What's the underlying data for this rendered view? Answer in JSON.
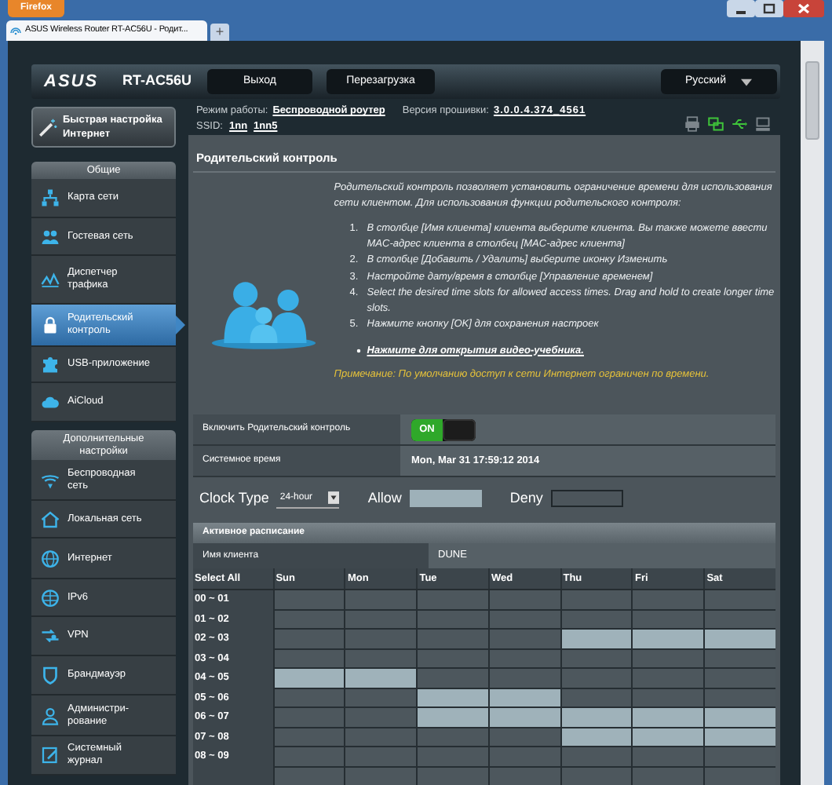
{
  "browser": {
    "menu_button": "Firefox",
    "tab_title": "ASUS Wireless Router RT-AC56U - Родит...",
    "new_tab": "+"
  },
  "header": {
    "logo": "ASUS",
    "model": "RT-AC56U",
    "buttons": [
      "Выход",
      "Перезагрузка"
    ],
    "language": "Русский"
  },
  "info": {
    "mode_label": "Режим работы:",
    "mode": "Беспроводной роутер",
    "firmware_label": "Версия прошивки:",
    "firmware": "3.0.0.4.374_4561",
    "ssid_label": "SSID:",
    "ssids": [
      "1nn",
      "1nn5"
    ]
  },
  "status_icons": [
    {
      "on": false
    },
    {
      "on": true
    },
    {
      "on": true
    },
    {
      "on": false
    }
  ],
  "quick_setup": "Быстрая настройка\nИнтернет",
  "sidebar": [
    {
      "title": "Общие",
      "items": [
        {
          "label": "Карта сети",
          "selected": false
        },
        {
          "label": "Гостевая сеть",
          "selected": false
        },
        {
          "label": "Диспетчер\nтрафика",
          "selected": false
        },
        {
          "label": "Родительский\nконтроль",
          "selected": true
        },
        {
          "label": "USB-приложение",
          "selected": false
        },
        {
          "label": "AiCloud",
          "selected": false
        }
      ]
    },
    {
      "title": "Дополнительные\nнастройки",
      "items": [
        {
          "label": "Беспроводная\nсеть",
          "selected": false
        },
        {
          "label": "Локальная сеть",
          "selected": false
        },
        {
          "label": "Интернет",
          "selected": false
        },
        {
          "label": "IPv6",
          "selected": false
        },
        {
          "label": "VPN",
          "selected": false
        },
        {
          "label": "Брандмауэр",
          "selected": false
        },
        {
          "label": "Администри-\nрование",
          "selected": false
        },
        {
          "label": "Системный\nжурнал",
          "selected": false
        }
      ]
    }
  ],
  "panel": {
    "title": "Родительский контроль",
    "description": "Родительский контроль позволяет установить ограничение времени для использования сети клиентом. Для использования функции родительского контроля:",
    "steps": [
      {
        "number": "1.",
        "text": "В столбце [Имя клиента] клиента выберите клиента. Вы также можете ввести MAC-адрес клиента в столбец [MAC-адрес клиента]"
      },
      {
        "number": "2.",
        "text": "В столбце [Добавить / Удалить] выберите иконку Изменить"
      },
      {
        "number": "3.",
        "text": "Настройте дату/время в столбце [Управление временем]"
      },
      {
        "number": "4.",
        "text": "Select the desired time slots for allowed access times. Drag and hold to create longer time slots."
      },
      {
        "number": "5.",
        "text": "Нажмите кнопку [OK] для сохранения настроек"
      }
    ],
    "video_link": "Нажмите для открытия видео-учебника.",
    "note": "Примечание: По умолчанию доступ к сети Интернет ограничен по времени."
  },
  "settings": [
    {
      "kind": "switch",
      "label": "Включить Родительский контроль",
      "value": "ON",
      "on": true
    },
    {
      "kind": "text",
      "label": "Системное время",
      "value": "Mon, Mar 31 17:59:12 2014"
    }
  ],
  "clock": {
    "label": "Clock Type",
    "value": "24-hour",
    "allow_label": "Allow",
    "deny_label": "Deny"
  },
  "schedule": {
    "title": "Активное расписание",
    "client_label": "Имя клиента",
    "client": "DUNE",
    "select_all": "Select All",
    "days": [
      "Sun",
      "Mon",
      "Tue",
      "Wed",
      "Thu",
      "Fri",
      "Sat"
    ],
    "rows": [
      {
        "label": "00 ~ 01",
        "allowed": [
          false,
          false,
          false,
          false,
          false,
          false,
          false
        ]
      },
      {
        "label": "01 ~ 02",
        "allowed": [
          false,
          false,
          false,
          false,
          false,
          false,
          false
        ]
      },
      {
        "label": "02 ~ 03",
        "allowed": [
          false,
          false,
          false,
          false,
          true,
          true,
          true
        ]
      },
      {
        "label": "03 ~ 04",
        "allowed": [
          false,
          false,
          false,
          false,
          false,
          false,
          false
        ]
      },
      {
        "label": "04 ~ 05",
        "allowed": [
          true,
          true,
          false,
          false,
          false,
          false,
          false
        ]
      },
      {
        "label": "05 ~ 06",
        "allowed": [
          false,
          false,
          true,
          true,
          false,
          false,
          false
        ]
      },
      {
        "label": "06 ~ 07",
        "allowed": [
          false,
          false,
          true,
          true,
          true,
          true,
          true
        ]
      },
      {
        "label": "07 ~ 08",
        "allowed": [
          false,
          false,
          false,
          false,
          true,
          true,
          true
        ]
      },
      {
        "label": "08 ~ 09",
        "allowed": [
          false,
          false,
          false,
          false,
          false,
          false,
          false
        ]
      }
    ]
  }
}
